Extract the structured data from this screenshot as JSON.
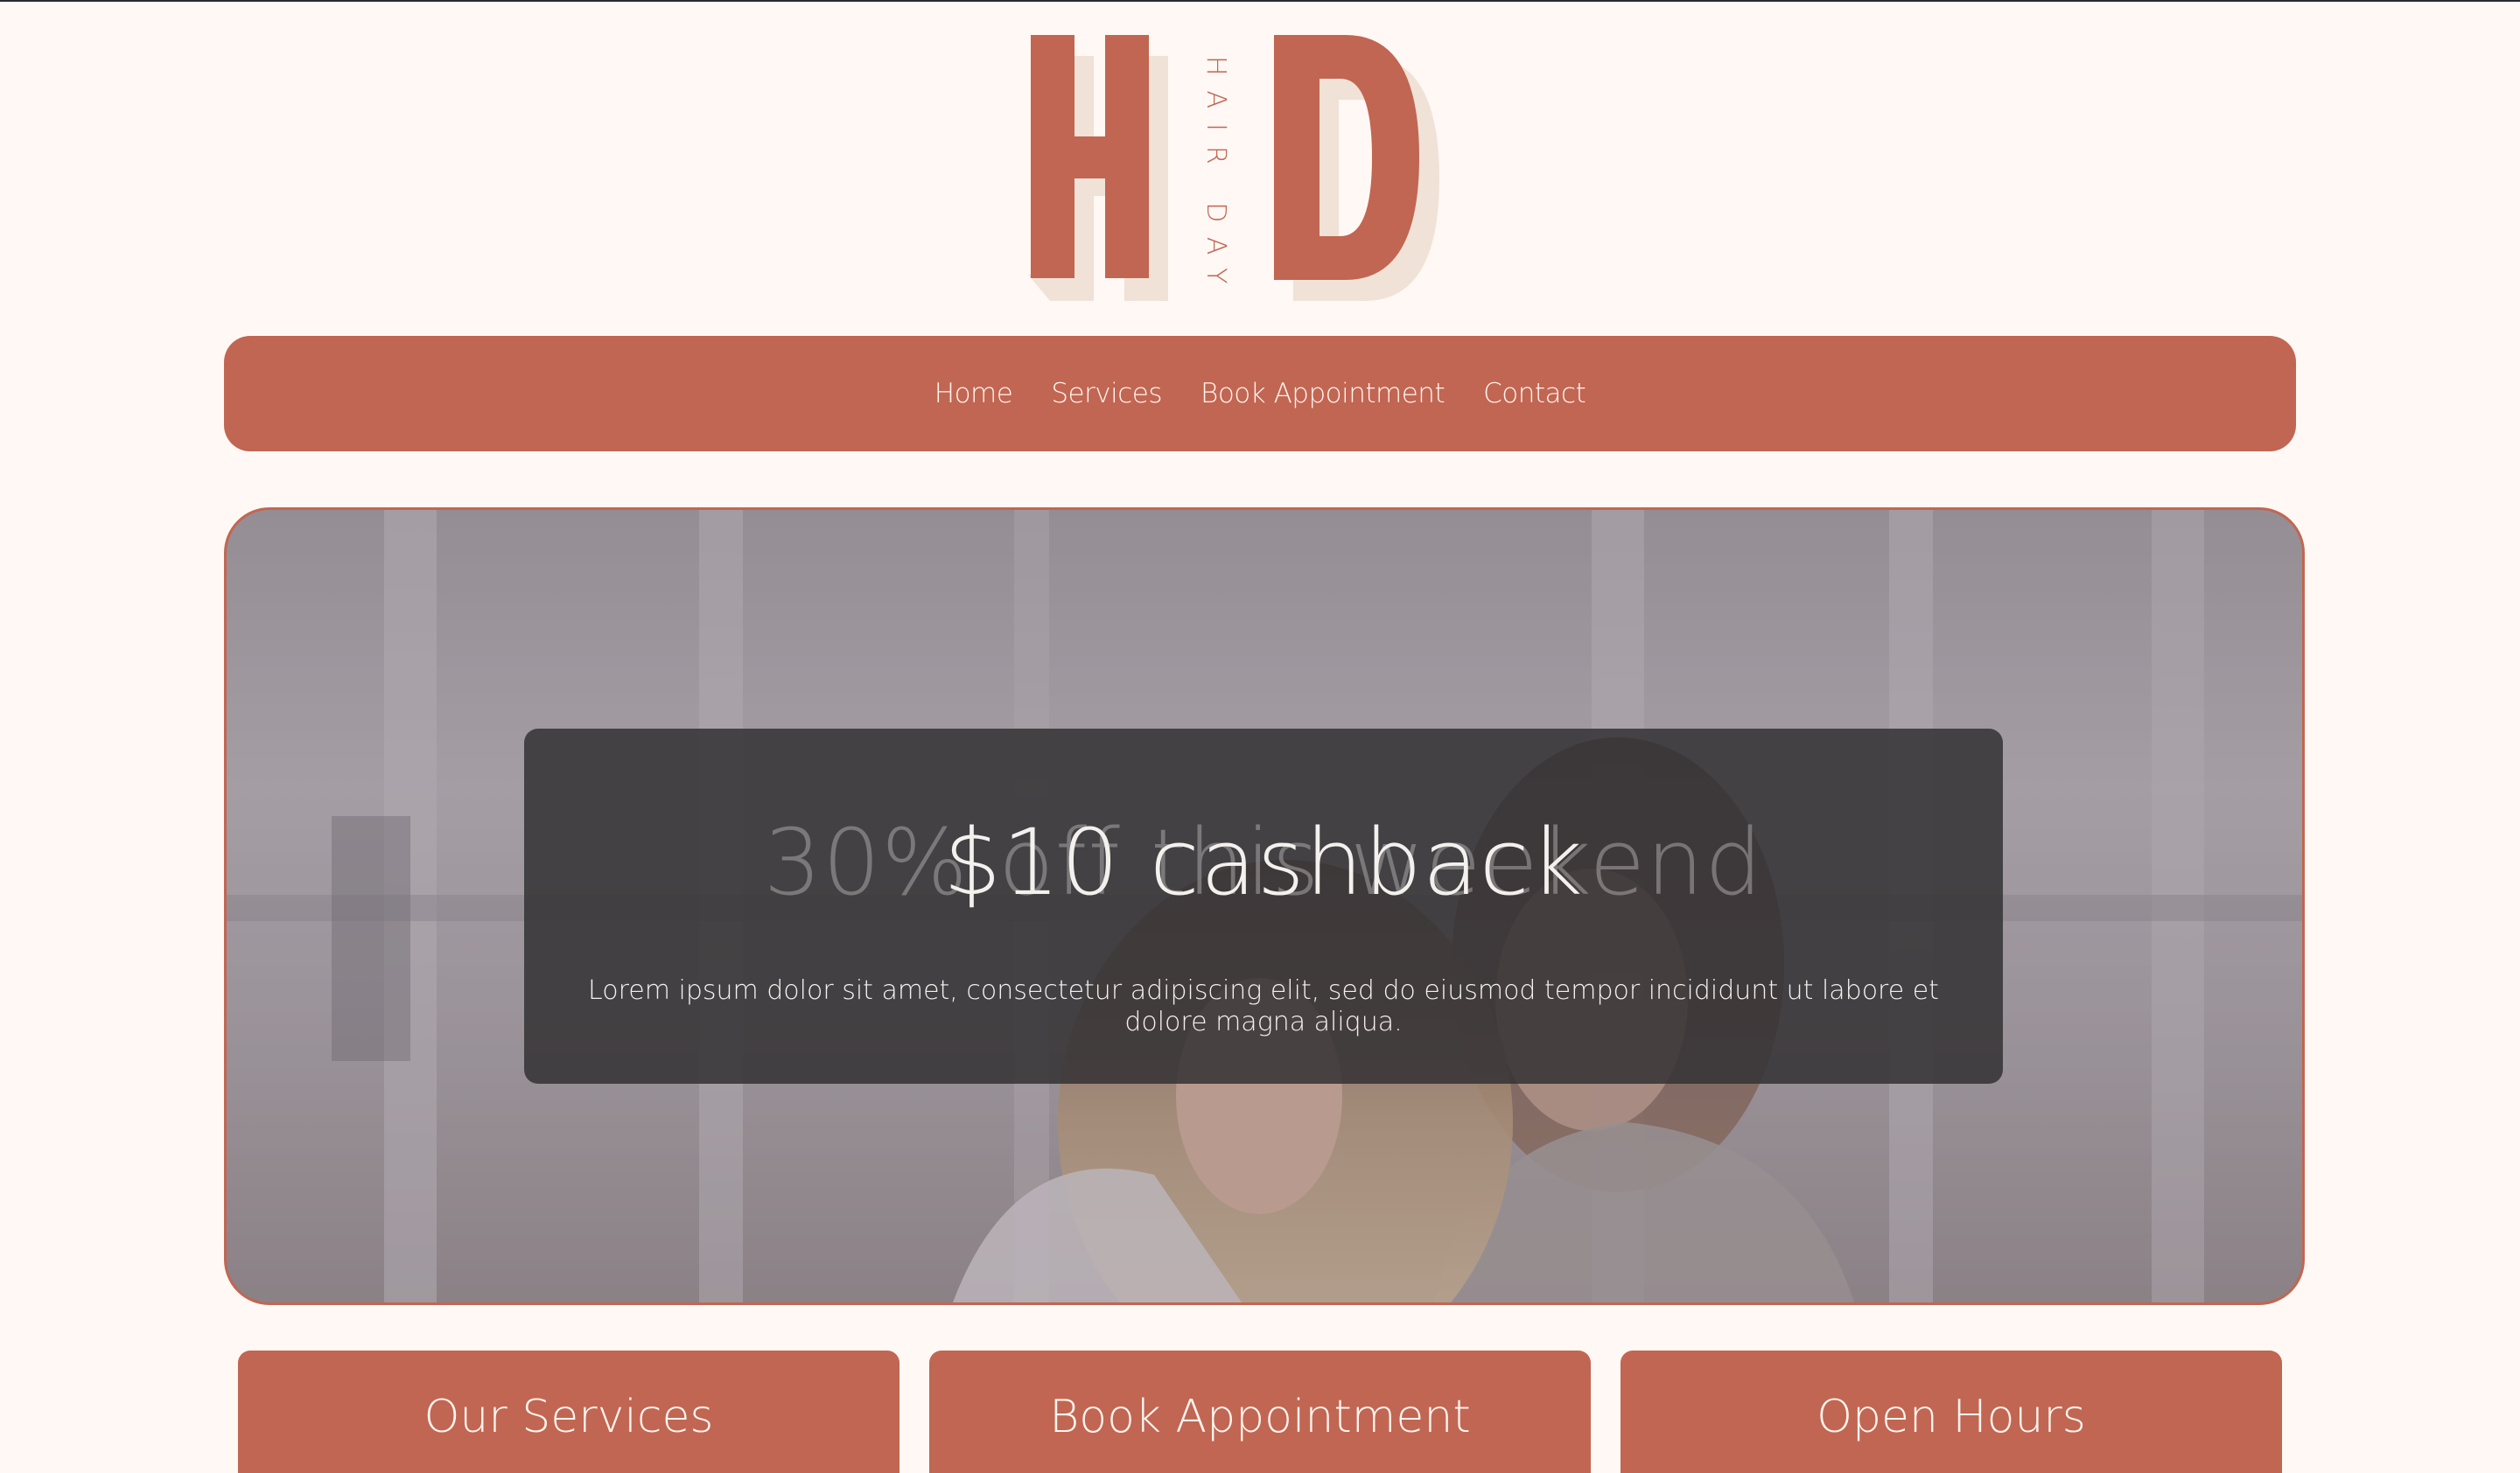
{
  "brand": {
    "letters": [
      "H",
      "D"
    ],
    "tagline": "HAIR DAY",
    "accent": "#c16652",
    "shadow": "#f0e2d7"
  },
  "nav": {
    "items": [
      {
        "label": "Home"
      },
      {
        "label": "Services"
      },
      {
        "label": "Book Appointment"
      },
      {
        "label": "Contact"
      }
    ]
  },
  "hero": {
    "background_description": "photo-of-two-women-in-salon",
    "promo": {
      "ghost_title": "30% off this weekend",
      "title": "$10 cashback",
      "text": "Lorem ipsum dolor sit amet, consectetur adipiscing elit, sed do eiusmod tempor incididunt ut labore et dolore magna aliqua."
    }
  },
  "cards": [
    {
      "label": "Our Services"
    },
    {
      "label": "Book Appointment"
    },
    {
      "label": "Open Hours"
    }
  ],
  "colors": {
    "page_bg": "#fff8f4",
    "accent": "#c16652",
    "promo_bg": "#343234",
    "light_text": "#fff4ee"
  }
}
